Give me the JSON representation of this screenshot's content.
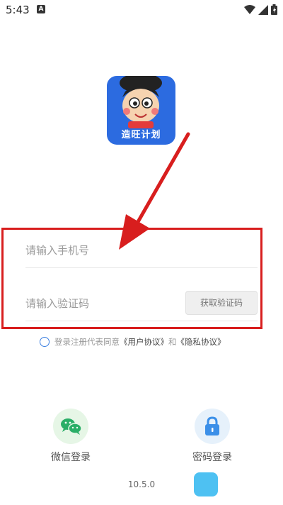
{
  "status_bar": {
    "time": "5:43",
    "notification_badge": "A",
    "icons": [
      "wifi-icon",
      "signal-icon",
      "battery-icon"
    ]
  },
  "app": {
    "logo_text": "造旺计划",
    "brand_color": "#2c6be0"
  },
  "form": {
    "phone_placeholder": "请输入手机号",
    "code_placeholder": "请输入验证码",
    "get_code_label": "获取验证码"
  },
  "agreement": {
    "prefix": "登录注册代表同意",
    "user_agreement": "《用户协议》",
    "and": "和",
    "privacy_agreement": "《隐私协议》"
  },
  "login_options": {
    "wechat_label": "微信登录",
    "password_label": "密码登录"
  },
  "footer": {
    "version": "10.5.0"
  },
  "colors": {
    "highlight": "#d81e1e",
    "accent": "#3b7fe0",
    "wechat": "#2aae67"
  }
}
